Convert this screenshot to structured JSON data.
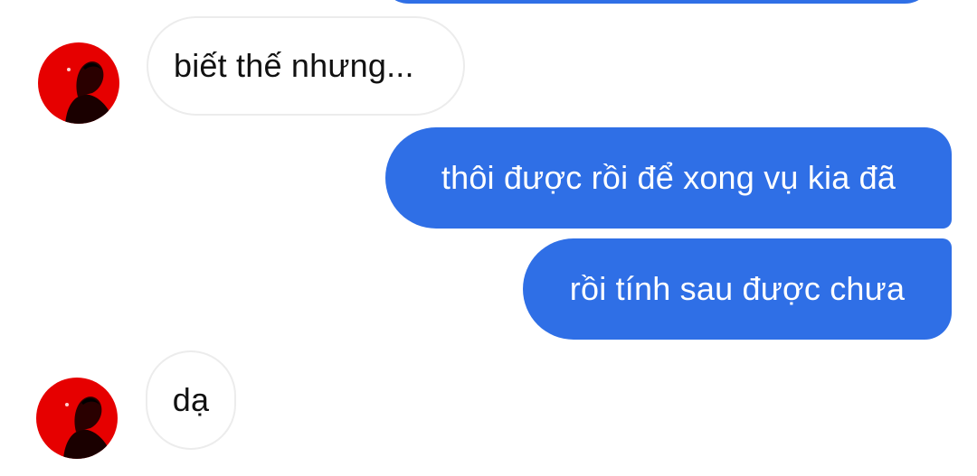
{
  "conversation": {
    "colors": {
      "outgoing_bubble": "#2f6fe6",
      "incoming_bubble": "#ffffff",
      "incoming_border": "#ececec",
      "avatar_accent": "#e60000"
    },
    "messages": [
      {
        "direction": "incoming",
        "text": "biết thế nhưng...",
        "avatar": "contact-avatar"
      },
      {
        "direction": "outgoing",
        "text": "thôi được rồi để xong vụ kia đã"
      },
      {
        "direction": "outgoing",
        "text": "rồi tính sau được chưa"
      },
      {
        "direction": "incoming",
        "text": "dạ",
        "avatar": "contact-avatar"
      }
    ]
  }
}
